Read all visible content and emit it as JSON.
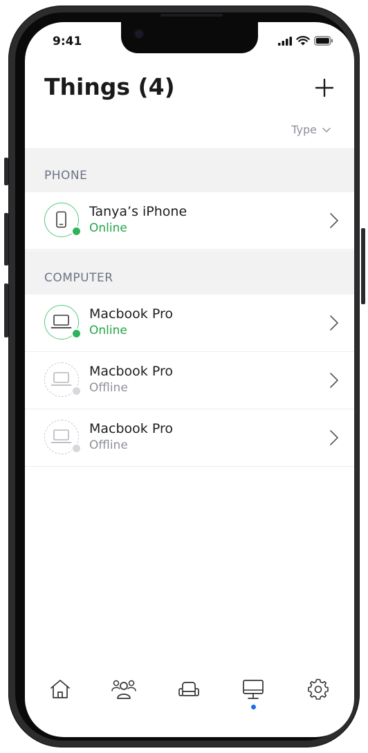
{
  "status_bar": {
    "time": "9:41"
  },
  "header": {
    "title": "Things (4)",
    "add_icon": "plus-icon"
  },
  "sort": {
    "label": "Type",
    "icon": "chevron-down-icon"
  },
  "sections": [
    {
      "title": "PHONE",
      "items": [
        {
          "name": "Tanya’s iPhone",
          "status": "Online",
          "icon": "smartphone-icon"
        }
      ]
    },
    {
      "title": "COMPUTER",
      "items": [
        {
          "name": "Macbook Pro",
          "status": "Online",
          "icon": "laptop-icon"
        },
        {
          "name": "Macbook Pro",
          "status": "Offline",
          "icon": "laptop-icon"
        },
        {
          "name": "Macbook Pro",
          "status": "Offline",
          "icon": "laptop-icon"
        }
      ]
    }
  ],
  "tabs": [
    {
      "icon": "home-icon"
    },
    {
      "icon": "people-icon"
    },
    {
      "icon": "sofa-icon"
    },
    {
      "icon": "monitor-icon",
      "active": true
    },
    {
      "icon": "settings-icon"
    }
  ],
  "colors": {
    "online": "#22a447",
    "offline": "#8d9099",
    "accent": "#1e6fe6",
    "section_bg": "#f2f2f3"
  }
}
